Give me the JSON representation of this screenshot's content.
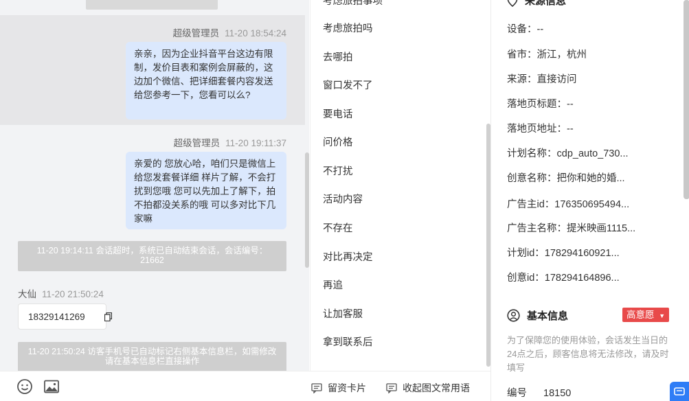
{
  "chat": {
    "messages": [
      {
        "sender": "超级管理员",
        "time": "11-20 18:54:24",
        "text": "亲亲，因为企业抖音平台这边有限制，发价目表和案例会屏蔽的，这边加个微信、把详细套餐内容发送给您参考一下，您看可以么?"
      },
      {
        "sender": "超级管理员",
        "time": "11-20 19:11:37",
        "text": "亲爱的 您放心哈，咱们只是微信上给您发套餐详细 样片了解，不会打扰到您哦 您可以先加上了解下，拍不拍都没关系的哦 可以多对比下几家嘛"
      }
    ],
    "system_1": "11-20 19:14:11 会话超时，系统已自动结束会话，会话编号：21662",
    "visitor": {
      "name": "大仙",
      "time": "11-20 21:50:24",
      "phone": "18329141269"
    },
    "system_2": "11-20 21:50:24 访客手机号已自动标记右侧基本信息栏，如需修改请在基本信息栏直接操作"
  },
  "input_bar": {
    "emoji_icon": "smiley-icon",
    "image_icon": "image-icon",
    "card_label": "留资卡片",
    "collapse_label": "收起图文常用语"
  },
  "quick_replies": [
    "考虑旅拍吗",
    "去哪拍",
    "窗口发不了",
    "要电话",
    "问价格",
    "不打扰",
    "活动内容",
    "不存在",
    "对比再决定",
    "再追",
    "让加客服",
    "拿到联系后"
  ],
  "info": {
    "source_rows": [
      "设备：--",
      "省市：浙江，杭州",
      "来源：直接访问",
      "落地页标题：--",
      "落地页地址：--",
      "计划名称：cdp_auto_730...",
      "创意名称：把你和她的婚...",
      "广告主id：176350695494...",
      "广告主名称：提米映画1115...",
      "计划id：178294160921...",
      "创意id：178294164896..."
    ],
    "basic_title": "基本信息",
    "intent_badge": "高意愿",
    "notice": "为了保障您的使用体验，会话发生当日的24点之后，顾客信息将无法修改，请及时填写",
    "id_label": "编号",
    "id_value": "18150"
  },
  "colors": {
    "bubble": "#dbe8fd",
    "badge": "#e84a4a",
    "accent": "#2f7df6"
  }
}
